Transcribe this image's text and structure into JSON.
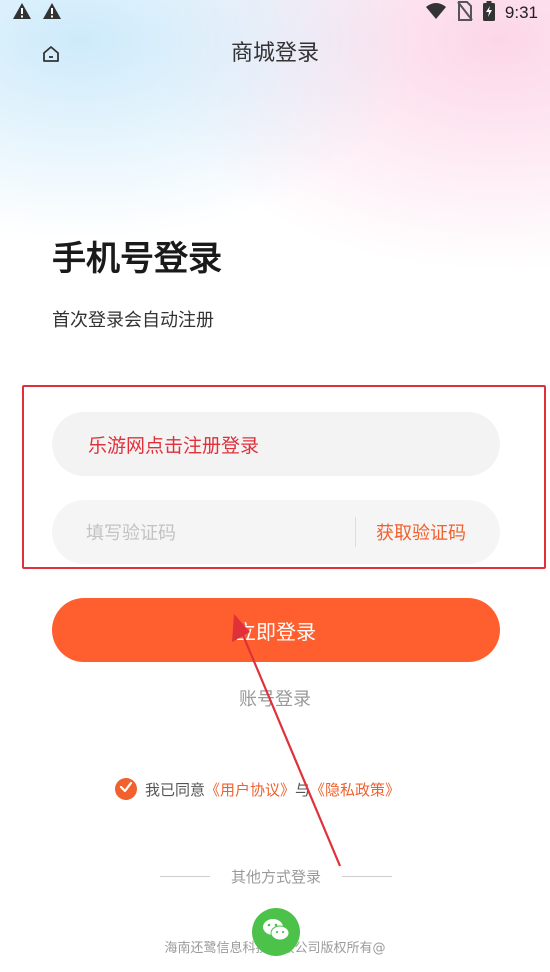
{
  "status_bar": {
    "time": "9:31",
    "icons": [
      "warning-icon",
      "warning-icon",
      "wifi-icon",
      "no-sim-icon",
      "battery-charging-icon"
    ]
  },
  "nav": {
    "home_icon": "home-icon",
    "title": "商城登录"
  },
  "heading": {
    "title": "手机号登录",
    "subtitle": "首次登录会自动注册"
  },
  "phone_input": {
    "value": "乐游网点击注册登录"
  },
  "code_input": {
    "placeholder": "填写验证码",
    "get_code_label": "获取验证码"
  },
  "login_button": {
    "label": "立即登录"
  },
  "account_login": {
    "label": "账号登录"
  },
  "agreement": {
    "prefix": "我已同意",
    "user_agreement": "《用户协议》",
    "connector": "与",
    "privacy_policy": "《隐私政策》"
  },
  "other_login": {
    "label": "其他方式登录",
    "wechat_icon": "wechat-icon"
  },
  "footer": {
    "copyright": "海南还鹭信息科技有限公司版权所有@"
  },
  "colors": {
    "accent": "#ff5f2e",
    "annotation_red": "#e0303a"
  }
}
